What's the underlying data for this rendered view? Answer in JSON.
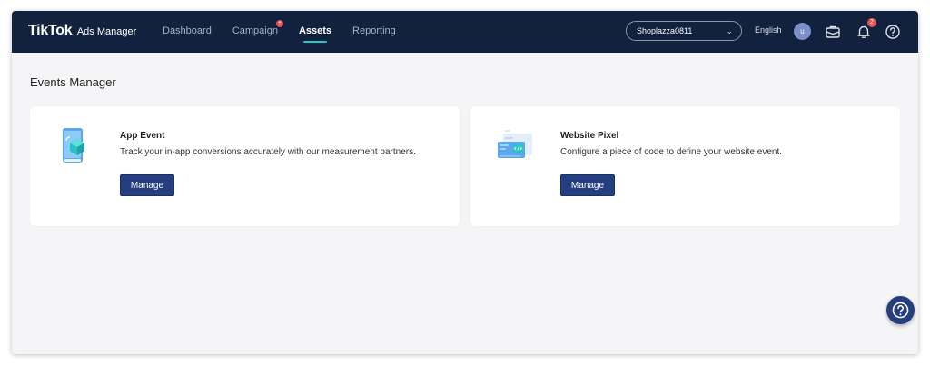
{
  "brand": {
    "logo": "TikTok",
    "dot": ":",
    "sub": "Ads Manager"
  },
  "nav": {
    "items": [
      {
        "label": "Dashboard"
      },
      {
        "label": "Campaign"
      },
      {
        "label": "Assets"
      },
      {
        "label": "Reporting"
      }
    ],
    "active": "Assets"
  },
  "header": {
    "account": "Shoplazza0811",
    "language": "English",
    "avatar_initial": "u",
    "notification_count": "2"
  },
  "page": {
    "title": "Events Manager"
  },
  "cards": [
    {
      "title": "App Event",
      "description": "Track your in-app conversions accurately with our measurement partners.",
      "button": "Manage",
      "icon": "mobile-app-illustration"
    },
    {
      "title": "Website Pixel",
      "description": "Configure a piece of code to define your website event.",
      "button": "Manage",
      "icon": "browser-code-illustration"
    }
  ],
  "colors": {
    "topbar": "#12213e",
    "accent": "#25c8c0",
    "button": "#253e7f",
    "badge": "#e5504f",
    "background": "#f5f5f7"
  },
  "icons": [
    "chevron-down-icon",
    "briefcase-icon",
    "bell-icon",
    "help-icon"
  ]
}
